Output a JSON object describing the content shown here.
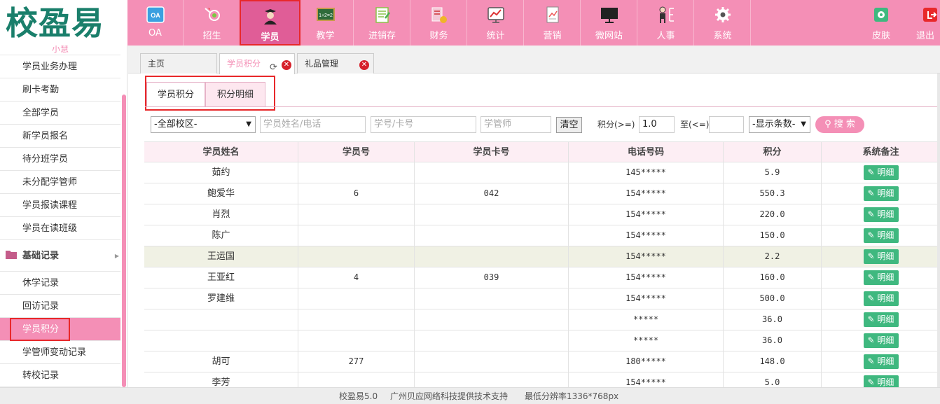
{
  "app": {
    "logo": "校盈易",
    "footer_version": "校盈易5.0",
    "footer_provider": "广州贝应网络科技提供技术支持",
    "footer_resolution": "最低分辨率1336*768px"
  },
  "nav": {
    "items": [
      {
        "label": "OA",
        "icon": "oa-icon"
      },
      {
        "label": "招生",
        "icon": "enroll-icon"
      },
      {
        "label": "学员",
        "icon": "student-icon",
        "active": true
      },
      {
        "label": "教学",
        "icon": "blackboard-icon"
      },
      {
        "label": "进销存",
        "icon": "inventory-icon"
      },
      {
        "label": "财务",
        "icon": "finance-icon"
      },
      {
        "label": "统计",
        "icon": "statistics-icon"
      },
      {
        "label": "营销",
        "icon": "marketing-icon"
      },
      {
        "label": "微网站",
        "icon": "monitor-icon"
      },
      {
        "label": "人事",
        "icon": "staff-icon"
      },
      {
        "label": "系统",
        "icon": "gear-icon"
      }
    ],
    "skin": "皮肤",
    "logout": "退出"
  },
  "sidebar": {
    "cut_top": "小慧",
    "items": [
      "学员业务办理",
      "刷卡考勤",
      "全部学员",
      "新学员报名",
      "待分班学员",
      "未分配学管师",
      "学员报读课程",
      "学员在读班级"
    ],
    "group": "基础记录",
    "group_items": [
      "休学记录",
      "回访记录",
      "学员积分",
      "学管师变动记录",
      "转校记录"
    ],
    "active": "学员积分"
  },
  "tabs": {
    "home": "主页",
    "points": "学员积分",
    "gifts": "礼品管理"
  },
  "subtabs": {
    "points": "学员积分",
    "detail": "积分明细"
  },
  "filters": {
    "campus": "-全部校区-",
    "name_placeholder": "学员姓名/电话",
    "card_placeholder": "学号/卡号",
    "manager_placeholder": "学管师",
    "clear": "清空",
    "min_label": "积分(>=)",
    "min_value": "1.0",
    "max_label": "至(<=)",
    "max_value": "",
    "count": "-显示条数-",
    "search": "搜 索"
  },
  "table": {
    "headers": [
      "学员姓名",
      "学员号",
      "学员卡号",
      "电话号码",
      "积分",
      "系统备注"
    ],
    "detail_label": "明细",
    "rows": [
      {
        "name": "茹约",
        "id": "",
        "card": "",
        "phone": "145*****",
        "points": "5.9"
      },
      {
        "name": "鲍爱华",
        "id": "6",
        "card": "042",
        "phone": "154*****",
        "points": "550.3"
      },
      {
        "name": "肖烈",
        "id": "",
        "card": "",
        "phone": "154*****",
        "points": "220.0"
      },
      {
        "name": "陈广",
        "id": "",
        "card": "",
        "phone": "154*****",
        "points": "150.0"
      },
      {
        "name": "王运国",
        "id": "",
        "card": "",
        "phone": "154*****",
        "points": "2.2"
      },
      {
        "name": "王亚红",
        "id": "4",
        "card": "039",
        "phone": "154*****",
        "points": "160.0"
      },
      {
        "name": "罗建维",
        "id": "",
        "card": "",
        "phone": "154*****",
        "points": "500.0"
      },
      {
        "name": "",
        "id": "",
        "card": "",
        "phone": "*****",
        "points": "36.0"
      },
      {
        "name": "",
        "id": "",
        "card": "",
        "phone": "*****",
        "points": "36.0"
      },
      {
        "name": "胡可",
        "id": "277",
        "card": "",
        "phone": "180*****",
        "points": "148.0"
      },
      {
        "name": "李芳",
        "id": "",
        "card": "",
        "phone": "154*****",
        "points": "5.0"
      }
    ]
  },
  "colors": {
    "brand_pink": "#f48fb6",
    "active_nav": "#e05d97",
    "logo_green": "#1a7f6b",
    "detail_green": "#3fb87f",
    "highlight_red": "#e8282a"
  }
}
